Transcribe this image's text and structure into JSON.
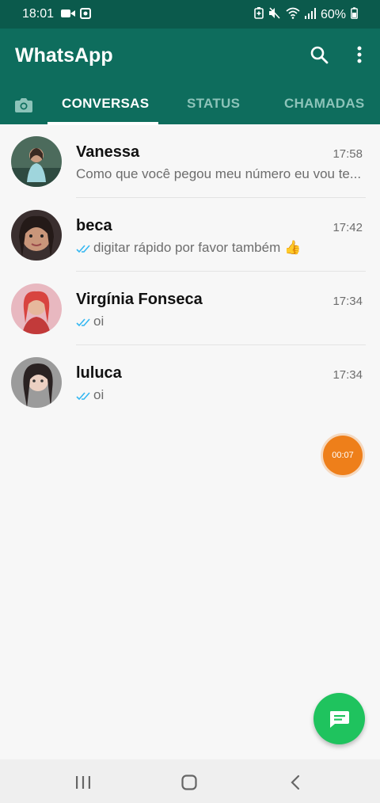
{
  "status_bar": {
    "time": "18:01",
    "battery": "60%",
    "icons": [
      "video-record-icon",
      "screen-record-icon",
      "battery-saver-icon",
      "mute-icon",
      "wifi-icon",
      "signal-icon",
      "battery-icon"
    ]
  },
  "app_bar": {
    "title": "WhatsApp",
    "background": "#0e6d5d",
    "status_background": "#0b5a4c"
  },
  "tabs": [
    {
      "label": "CONVERSAS",
      "active": true
    },
    {
      "label": "STATUS",
      "active": false
    },
    {
      "label": "CHAMADAS",
      "active": false
    }
  ],
  "chats": [
    {
      "name": "Vanessa",
      "time": "17:58",
      "preview": "Como que você pegou meu número eu vou te...",
      "read_ticks": false
    },
    {
      "name": "beca",
      "time": "17:42",
      "preview": "digitar  rápido por favor também 👍",
      "read_ticks": true
    },
    {
      "name": "Virgínia Fonseca",
      "time": "17:34",
      "preview": "oi",
      "read_ticks": true
    },
    {
      "name": "luluca",
      "time": "17:34",
      "preview": "oi",
      "read_ticks": true
    }
  ],
  "recording": {
    "timer": "00:07",
    "color": "#ee7f1a"
  },
  "fab": {
    "icon": "new-chat-icon",
    "color": "#1fc35e"
  },
  "tick_color": "#34b7f1"
}
